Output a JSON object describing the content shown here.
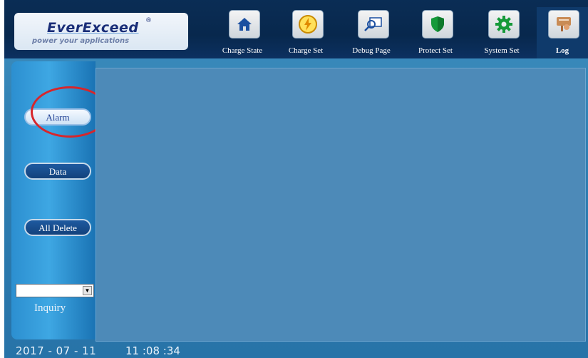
{
  "brand": {
    "name": "EverExceed",
    "registered_mark": "®",
    "tagline": "power your applications"
  },
  "nav": {
    "tabs": [
      {
        "label": "Charge State",
        "icon": "home-icon",
        "color": "#1b4fa0"
      },
      {
        "label": "Charge Set",
        "icon": "lightning-icon",
        "color": "#e0a400"
      },
      {
        "label": "Debug Page",
        "icon": "magnifier-icon",
        "color": "#1b4fa0"
      },
      {
        "label": "Protect Set",
        "icon": "shield-icon",
        "color": "#169a3a"
      },
      {
        "label": "System Set",
        "icon": "gear-icon",
        "color": "#169a3a"
      },
      {
        "label": "Log",
        "icon": "log-icon",
        "color": "#b8733a"
      }
    ],
    "active": "Log"
  },
  "side": {
    "alarm_label": "Alarm",
    "data_label": "Data",
    "all_delete_label": "All Delete",
    "inquiry_label": "Inquiry",
    "inquiry_value": ""
  },
  "status": {
    "date": "2017 - 07 - 11",
    "time": "11 :08 :34"
  },
  "colors": {
    "header_bg": "#08284d",
    "screen_bg": "#2f7fb2",
    "content_bg": "#4d8ab8",
    "highlight": "#d7262b"
  }
}
